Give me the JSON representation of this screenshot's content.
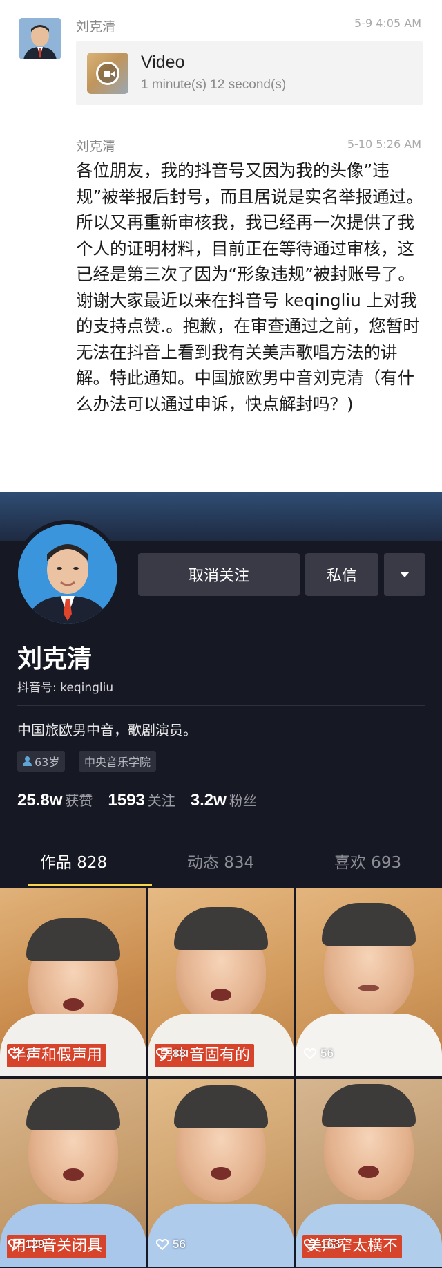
{
  "chat": {
    "messages": [
      {
        "sender": "刘克清",
        "time": "5-9 4:05 AM",
        "video": {
          "title": "Video",
          "duration": "1 minute(s) 12 second(s)"
        }
      },
      {
        "sender": "刘克清",
        "time": "5-10 5:26 AM",
        "text": "各位朋友，我的抖音号又因为我的头像”违规”被举报后封号，而且居说是实名举报通过。所以又再重新审核我，我已经再一次提供了我个人的证明材料，目前正在等待通过审核，这已经是第三次了因为“形象违规”被封账号了。谢谢大家最近以来在抖音号 keqingliu 上对我的支持点赞.。抱歉，在审查通过之前，您暂时无法在抖音上看到我有关美声歌唱方法的讲解。特此通知。中国旅欧男中音刘克清（有什么办法可以通过申诉，快点解封吗？)"
      }
    ]
  },
  "profile": {
    "buttons": {
      "unfollow": "取消关注",
      "message": "私信"
    },
    "name": "刘克清",
    "douyin_id": "抖音号: keqingliu",
    "bio": "中国旅欧男中音，歌剧演员。",
    "tags": {
      "age": "63岁",
      "school": "中央音乐学院"
    },
    "stats": {
      "likes_num": "25.8w",
      "likes_label": "获赞",
      "following_num": "1593",
      "following_label": "关注",
      "followers_num": "3.2w",
      "followers_label": "粉丝"
    },
    "tabs": [
      "作品 828",
      "动态 834",
      "喜欢 693"
    ],
    "accent_color": "#fbd64a",
    "background_color": "#161823"
  },
  "videos": [
    {
      "likes": "7",
      "caption": "半声和假声用"
    },
    {
      "likes": "88",
      "caption": "男中音固有的"
    },
    {
      "likes": "56",
      "caption": ""
    },
    {
      "likes": "129",
      "caption": "用中音关闭具"
    },
    {
      "likes": "56",
      "caption": ""
    },
    {
      "likes": "163",
      "caption": "美声窄太横不"
    }
  ]
}
